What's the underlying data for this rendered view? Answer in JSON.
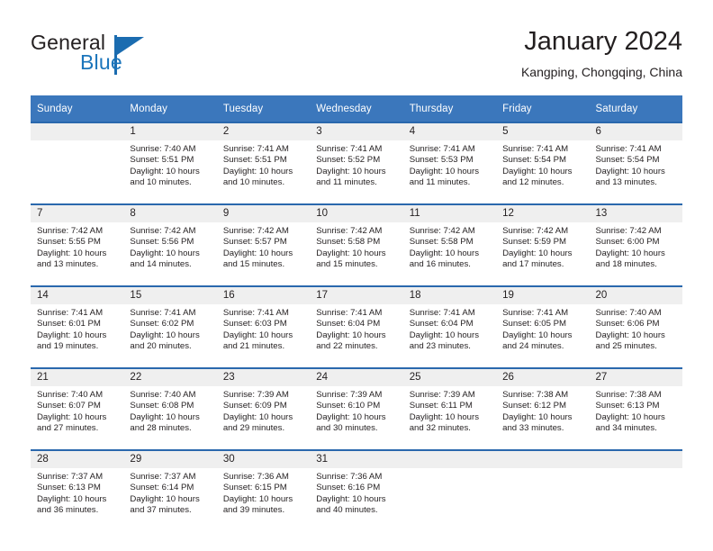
{
  "brand": {
    "name_part1": "General",
    "name_part2": "Blue",
    "logo_icon": "triangle-flag-icon"
  },
  "header": {
    "title": "January 2024",
    "subtitle": "Kangping, Chongqing, China"
  },
  "calendar": {
    "weekday_headers": [
      "Sunday",
      "Monday",
      "Tuesday",
      "Wednesday",
      "Thursday",
      "Friday",
      "Saturday"
    ],
    "colors": {
      "header_background": "#3b77bc",
      "week_divider": "#2a68ad",
      "daynum_background": "#efefef",
      "text": "#231f20",
      "brand_blue": "#1b75bb"
    },
    "weeks": [
      [
        {
          "day": "",
          "sunrise": "",
          "sunset": "",
          "daylight_line1": "",
          "daylight_line2": ""
        },
        {
          "day": "1",
          "sunrise": "Sunrise: 7:40 AM",
          "sunset": "Sunset: 5:51 PM",
          "daylight_line1": "Daylight: 10 hours",
          "daylight_line2": "and 10 minutes."
        },
        {
          "day": "2",
          "sunrise": "Sunrise: 7:41 AM",
          "sunset": "Sunset: 5:51 PM",
          "daylight_line1": "Daylight: 10 hours",
          "daylight_line2": "and 10 minutes."
        },
        {
          "day": "3",
          "sunrise": "Sunrise: 7:41 AM",
          "sunset": "Sunset: 5:52 PM",
          "daylight_line1": "Daylight: 10 hours",
          "daylight_line2": "and 11 minutes."
        },
        {
          "day": "4",
          "sunrise": "Sunrise: 7:41 AM",
          "sunset": "Sunset: 5:53 PM",
          "daylight_line1": "Daylight: 10 hours",
          "daylight_line2": "and 11 minutes."
        },
        {
          "day": "5",
          "sunrise": "Sunrise: 7:41 AM",
          "sunset": "Sunset: 5:54 PM",
          "daylight_line1": "Daylight: 10 hours",
          "daylight_line2": "and 12 minutes."
        },
        {
          "day": "6",
          "sunrise": "Sunrise: 7:41 AM",
          "sunset": "Sunset: 5:54 PM",
          "daylight_line1": "Daylight: 10 hours",
          "daylight_line2": "and 13 minutes."
        }
      ],
      [
        {
          "day": "7",
          "sunrise": "Sunrise: 7:42 AM",
          "sunset": "Sunset: 5:55 PM",
          "daylight_line1": "Daylight: 10 hours",
          "daylight_line2": "and 13 minutes."
        },
        {
          "day": "8",
          "sunrise": "Sunrise: 7:42 AM",
          "sunset": "Sunset: 5:56 PM",
          "daylight_line1": "Daylight: 10 hours",
          "daylight_line2": "and 14 minutes."
        },
        {
          "day": "9",
          "sunrise": "Sunrise: 7:42 AM",
          "sunset": "Sunset: 5:57 PM",
          "daylight_line1": "Daylight: 10 hours",
          "daylight_line2": "and 15 minutes."
        },
        {
          "day": "10",
          "sunrise": "Sunrise: 7:42 AM",
          "sunset": "Sunset: 5:58 PM",
          "daylight_line1": "Daylight: 10 hours",
          "daylight_line2": "and 15 minutes."
        },
        {
          "day": "11",
          "sunrise": "Sunrise: 7:42 AM",
          "sunset": "Sunset: 5:58 PM",
          "daylight_line1": "Daylight: 10 hours",
          "daylight_line2": "and 16 minutes."
        },
        {
          "day": "12",
          "sunrise": "Sunrise: 7:42 AM",
          "sunset": "Sunset: 5:59 PM",
          "daylight_line1": "Daylight: 10 hours",
          "daylight_line2": "and 17 minutes."
        },
        {
          "day": "13",
          "sunrise": "Sunrise: 7:42 AM",
          "sunset": "Sunset: 6:00 PM",
          "daylight_line1": "Daylight: 10 hours",
          "daylight_line2": "and 18 minutes."
        }
      ],
      [
        {
          "day": "14",
          "sunrise": "Sunrise: 7:41 AM",
          "sunset": "Sunset: 6:01 PM",
          "daylight_line1": "Daylight: 10 hours",
          "daylight_line2": "and 19 minutes."
        },
        {
          "day": "15",
          "sunrise": "Sunrise: 7:41 AM",
          "sunset": "Sunset: 6:02 PM",
          "daylight_line1": "Daylight: 10 hours",
          "daylight_line2": "and 20 minutes."
        },
        {
          "day": "16",
          "sunrise": "Sunrise: 7:41 AM",
          "sunset": "Sunset: 6:03 PM",
          "daylight_line1": "Daylight: 10 hours",
          "daylight_line2": "and 21 minutes."
        },
        {
          "day": "17",
          "sunrise": "Sunrise: 7:41 AM",
          "sunset": "Sunset: 6:04 PM",
          "daylight_line1": "Daylight: 10 hours",
          "daylight_line2": "and 22 minutes."
        },
        {
          "day": "18",
          "sunrise": "Sunrise: 7:41 AM",
          "sunset": "Sunset: 6:04 PM",
          "daylight_line1": "Daylight: 10 hours",
          "daylight_line2": "and 23 minutes."
        },
        {
          "day": "19",
          "sunrise": "Sunrise: 7:41 AM",
          "sunset": "Sunset: 6:05 PM",
          "daylight_line1": "Daylight: 10 hours",
          "daylight_line2": "and 24 minutes."
        },
        {
          "day": "20",
          "sunrise": "Sunrise: 7:40 AM",
          "sunset": "Sunset: 6:06 PM",
          "daylight_line1": "Daylight: 10 hours",
          "daylight_line2": "and 25 minutes."
        }
      ],
      [
        {
          "day": "21",
          "sunrise": "Sunrise: 7:40 AM",
          "sunset": "Sunset: 6:07 PM",
          "daylight_line1": "Daylight: 10 hours",
          "daylight_line2": "and 27 minutes."
        },
        {
          "day": "22",
          "sunrise": "Sunrise: 7:40 AM",
          "sunset": "Sunset: 6:08 PM",
          "daylight_line1": "Daylight: 10 hours",
          "daylight_line2": "and 28 minutes."
        },
        {
          "day": "23",
          "sunrise": "Sunrise: 7:39 AM",
          "sunset": "Sunset: 6:09 PM",
          "daylight_line1": "Daylight: 10 hours",
          "daylight_line2": "and 29 minutes."
        },
        {
          "day": "24",
          "sunrise": "Sunrise: 7:39 AM",
          "sunset": "Sunset: 6:10 PM",
          "daylight_line1": "Daylight: 10 hours",
          "daylight_line2": "and 30 minutes."
        },
        {
          "day": "25",
          "sunrise": "Sunrise: 7:39 AM",
          "sunset": "Sunset: 6:11 PM",
          "daylight_line1": "Daylight: 10 hours",
          "daylight_line2": "and 32 minutes."
        },
        {
          "day": "26",
          "sunrise": "Sunrise: 7:38 AM",
          "sunset": "Sunset: 6:12 PM",
          "daylight_line1": "Daylight: 10 hours",
          "daylight_line2": "and 33 minutes."
        },
        {
          "day": "27",
          "sunrise": "Sunrise: 7:38 AM",
          "sunset": "Sunset: 6:13 PM",
          "daylight_line1": "Daylight: 10 hours",
          "daylight_line2": "and 34 minutes."
        }
      ],
      [
        {
          "day": "28",
          "sunrise": "Sunrise: 7:37 AM",
          "sunset": "Sunset: 6:13 PM",
          "daylight_line1": "Daylight: 10 hours",
          "daylight_line2": "and 36 minutes."
        },
        {
          "day": "29",
          "sunrise": "Sunrise: 7:37 AM",
          "sunset": "Sunset: 6:14 PM",
          "daylight_line1": "Daylight: 10 hours",
          "daylight_line2": "and 37 minutes."
        },
        {
          "day": "30",
          "sunrise": "Sunrise: 7:36 AM",
          "sunset": "Sunset: 6:15 PM",
          "daylight_line1": "Daylight: 10 hours",
          "daylight_line2": "and 39 minutes."
        },
        {
          "day": "31",
          "sunrise": "Sunrise: 7:36 AM",
          "sunset": "Sunset: 6:16 PM",
          "daylight_line1": "Daylight: 10 hours",
          "daylight_line2": "and 40 minutes."
        },
        {
          "day": "",
          "sunrise": "",
          "sunset": "",
          "daylight_line1": "",
          "daylight_line2": ""
        },
        {
          "day": "",
          "sunrise": "",
          "sunset": "",
          "daylight_line1": "",
          "daylight_line2": ""
        },
        {
          "day": "",
          "sunrise": "",
          "sunset": "",
          "daylight_line1": "",
          "daylight_line2": ""
        }
      ]
    ]
  }
}
